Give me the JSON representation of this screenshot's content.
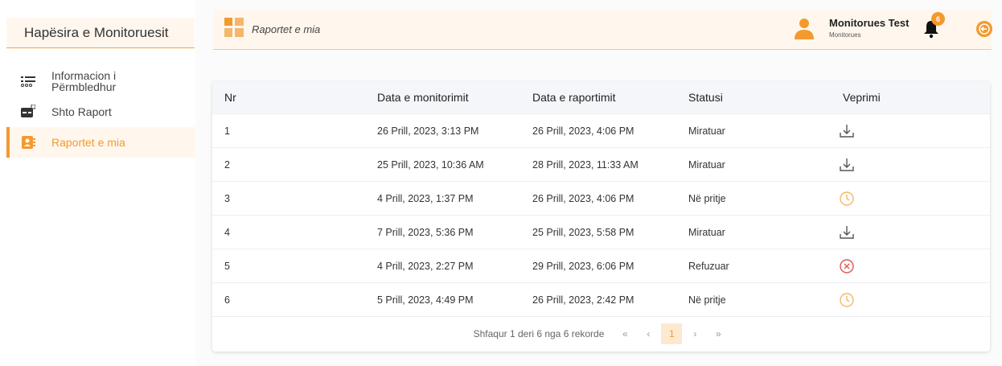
{
  "sidebar": {
    "title": "Hapësira e Monitoruesit",
    "items": [
      {
        "label_line1": "Informacion i",
        "label_line2": "Përmbledhur",
        "icon": "list-icon"
      },
      {
        "label": "Shto Raport",
        "icon": "add-report-icon"
      },
      {
        "label": "Raportet e mia",
        "icon": "contacts-book-icon",
        "active": true
      }
    ]
  },
  "header": {
    "breadcrumb": "Raportet e mia",
    "user_name": "Monitorues Test",
    "user_role": "Monitorues",
    "notification_count": "6"
  },
  "table": {
    "columns": [
      "Nr",
      "Data e monitorimit",
      "Data e raportimit",
      "Statusi",
      "Veprimi"
    ],
    "rows": [
      {
        "nr": "1",
        "monitorimit": "26 Prill, 2023, 3:13 PM",
        "raportimit": "26 Prill, 2023, 4:06 PM",
        "statusi": "Miratuar",
        "action": "download-icon"
      },
      {
        "nr": "2",
        "monitorimit": "25 Prill, 2023, 10:36 AM",
        "raportimit": "28 Prill, 2023, 11:33 AM",
        "statusi": "Miratuar",
        "action": "download-icon"
      },
      {
        "nr": "3",
        "monitorimit": "4 Prill, 2023, 1:37 PM",
        "raportimit": "26 Prill, 2023, 4:06 PM",
        "statusi": "Në pritje",
        "action": "clock-icon"
      },
      {
        "nr": "4",
        "monitorimit": "7 Prill, 2023, 5:36 PM",
        "raportimit": "25 Prill, 2023, 5:58 PM",
        "statusi": "Miratuar",
        "action": "download-icon"
      },
      {
        "nr": "5",
        "monitorimit": "4 Prill, 2023, 2:27 PM",
        "raportimit": "29 Prill, 2023, 6:06 PM",
        "statusi": "Refuzuar",
        "action": "rejected-icon"
      },
      {
        "nr": "6",
        "monitorimit": "5 Prill, 2023, 4:49 PM",
        "raportimit": "26 Prill, 2023, 2:42 PM",
        "statusi": "Në pritje",
        "action": "clock-icon"
      }
    ],
    "pagination": {
      "info": "Shfaqur 1 deri 6 nga 6 rekorde",
      "first": "«",
      "prev": "‹",
      "current": "1",
      "next": "›",
      "last": "»"
    }
  },
  "colors": {
    "accent": "#f39a2e",
    "rejected": "#e05555",
    "pending": "#f5b66a"
  }
}
